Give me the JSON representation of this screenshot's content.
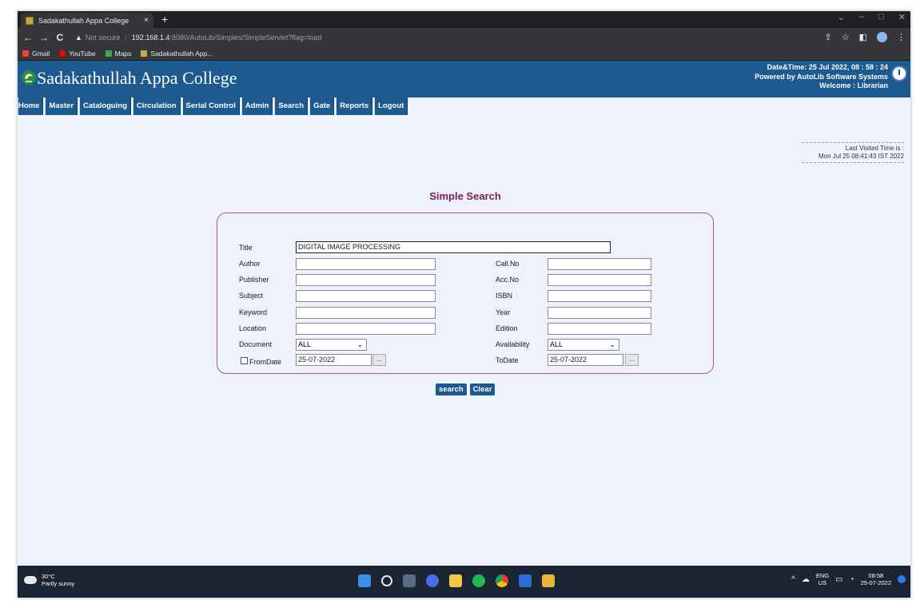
{
  "browser": {
    "tab_title": "Sadakathullah Appa College",
    "tab_close": "×",
    "new_tab": "+",
    "window_controls": [
      "⌄",
      "–",
      "□",
      "✕"
    ],
    "nav": {
      "back": "←",
      "forward": "→",
      "reload": "C"
    },
    "address": {
      "warning_icon": "▲",
      "not_secure": "Not secure",
      "separator": "|",
      "host": "192.168.1.4",
      "path": ":8080/AutoLib/Simples/SimpleServlet?flag=load"
    },
    "toolbar_icons": [
      "⇪",
      "☆",
      "◧"
    ],
    "bookmarks": [
      {
        "label": "Gmail",
        "color": "#ea4335"
      },
      {
        "label": "YouTube",
        "color": "#ff0000"
      },
      {
        "label": "Maps",
        "color": "#34a853"
      },
      {
        "label": "Sadakathullah App...",
        "color": "#c8a64a"
      }
    ]
  },
  "app": {
    "college_name": "Sadakathullah Appa College",
    "datetime_line": "Date&Time:  25 Jul 2022, 08 : 58 : 24",
    "powered_by": "Powered by AutoLib Software Systems",
    "welcome": "Welcome  :  Librarian",
    "menu": [
      "Home",
      "Master",
      "Cataloguing",
      "Circulation",
      "Serial Control",
      "Admin",
      "Search",
      "Gate",
      "Reports",
      "Logout"
    ],
    "last_visited_label": "Last Visited Time is :",
    "last_visited_value": "Mon Jul 25 08:41:43 IST 2022",
    "page_title": "Simple Search",
    "colors": {
      "header": "#1d5a8f",
      "title": "#7a1f5c",
      "box_border": "#a05c8a"
    }
  },
  "form": {
    "title_label": "Title",
    "title_value": "DIGITAL IMAGE PROCESSING",
    "author_label": "Author",
    "publisher_label": "Publisher",
    "subject_label": "Subject",
    "keyword_label": "Keyword",
    "location_label": "Location",
    "document_label": "Document",
    "document_value": "ALL",
    "fromdate_label": "FromDate",
    "fromdate_value": "25-07-2022",
    "callno_label": "Call.No",
    "accno_label": "Acc.No",
    "isbn_label": "ISBN",
    "year_label": "Year",
    "edition_label": "Edition",
    "availability_label": "Availability",
    "availability_value": "ALL",
    "todate_label": "ToDate",
    "todate_value": "25-07-2022",
    "date_button": "...",
    "search_button": "search",
    "clear_button": "Clear"
  },
  "taskbar": {
    "temperature": "30°C",
    "weather": "Partly sunny",
    "lang_top": "ENG",
    "lang_bottom": "US",
    "time": "08:58",
    "date": "25-07-2022",
    "tray_up": "^",
    "icons": [
      {
        "name": "windows-start",
        "color": "#3b8eea"
      },
      {
        "name": "search",
        "color": "#1b2433"
      },
      {
        "name": "task-view",
        "color": "#5a6b85"
      },
      {
        "name": "chat",
        "color": "#4b6ee8"
      },
      {
        "name": "file-explorer",
        "color": "#f2c744"
      },
      {
        "name": "spotify",
        "color": "#1db954"
      },
      {
        "name": "chrome",
        "color": "#e34133"
      },
      {
        "name": "word",
        "color": "#2b6fd6"
      },
      {
        "name": "app",
        "color": "#e8b43a"
      }
    ]
  }
}
